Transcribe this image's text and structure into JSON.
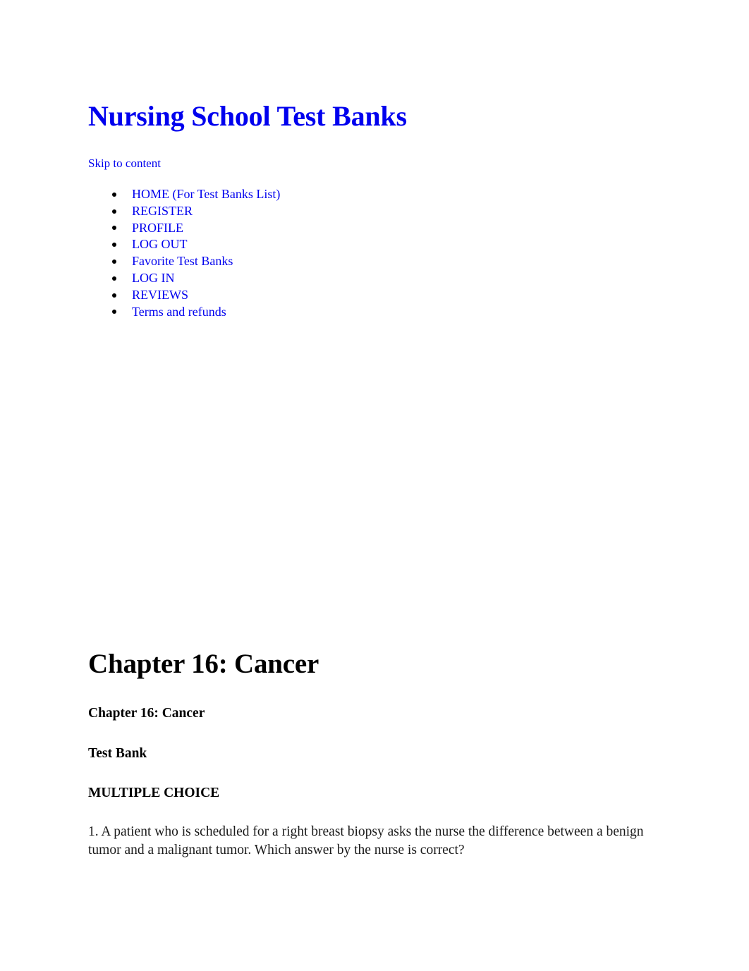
{
  "site": {
    "title": "Nursing School Test Banks",
    "skip_link": "Skip to content",
    "title_color": "#0000ee",
    "link_color": "#0000ee"
  },
  "nav": {
    "items": [
      {
        "label": "HOME (For Test Banks List)"
      },
      {
        "label": "REGISTER"
      },
      {
        "label": "PROFILE"
      },
      {
        "label": "LOG OUT"
      },
      {
        "label": "Favorite Test Banks"
      },
      {
        "label": "LOG IN"
      },
      {
        "label": "REVIEWS"
      },
      {
        "label": "Terms and refunds"
      }
    ]
  },
  "article": {
    "entry_title": "Chapter 16: Cancer",
    "chapter_heading": "Chapter 16: Cancer",
    "test_bank_heading": "Test Bank",
    "section_heading": "MULTIPLE CHOICE",
    "question_1": "1. A patient who is scheduled for a right breast biopsy asks the nurse the difference between a benign tumor and a malignant tumor. Which answer by the nurse is correct?"
  }
}
